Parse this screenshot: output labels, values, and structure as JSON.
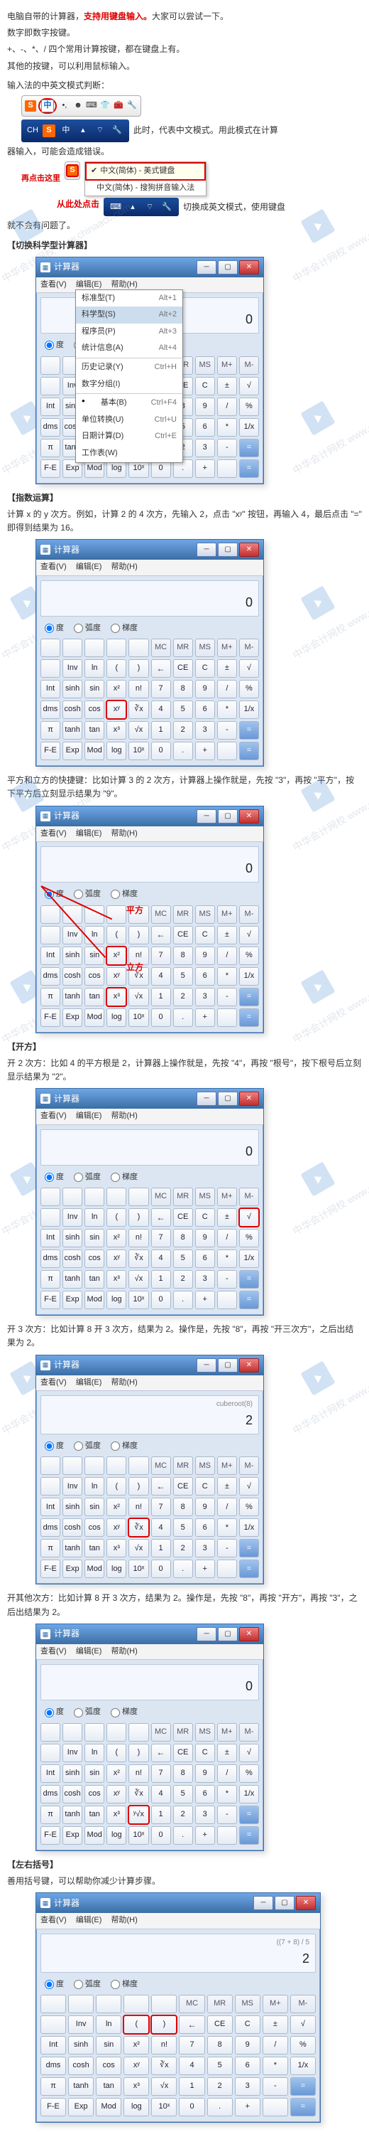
{
  "wm_text": "中华会计网校 www.chinaacc.com",
  "intro": {
    "line1a": "电脑自带的计算器，",
    "line1b": "支持用键盘输入。",
    "line1c": "大家可以尝试一下。",
    "line2": "数字即数字按键。",
    "line3": "+、-、*、/ 四个常用计算按键，都在键盘上有。",
    "line4": "其他的按键，可以利用鼠标输入。",
    "ime_intro": "输入法的中英文模式判断："
  },
  "ime": {
    "cn_char": "中",
    "ch_label": "CH",
    "txt_after_bar": "此时，代表中文模式。用此模式在计算",
    "txt_after_bar2": "器输入，可能会造成错误。",
    "click_here": "再点击这里",
    "menu_opt1": "中文(简体) - 美式键盘",
    "menu_opt2": "中文(简体) - 搜狗拼音输入法",
    "from_here": "从此处点击",
    "switch_en": "切换成英文模式，使用键盘",
    "no_problem": "就不会有问题了。"
  },
  "calc_title": "计算器",
  "menus": {
    "view": "查看(V)",
    "edit": "编辑(E)",
    "help": "帮助(H)"
  },
  "angle_modes": {
    "deg": "度",
    "rad": "弧度",
    "grad": "梯度"
  },
  "mem_row": [
    "MC",
    "MR",
    "MS",
    "M+",
    "M-"
  ],
  "sci_cols_left": [
    [
      "",
      "Inv",
      "ln",
      "(",
      ")"
    ],
    [
      "Int",
      "sinh",
      "sin",
      "x²",
      "n!"
    ],
    [
      "dms",
      "cosh",
      "cos",
      "xʸ",
      "∛x"
    ],
    [
      "π",
      "tanh",
      "tan",
      "x³",
      "√x"
    ],
    [
      "F-E",
      "Exp",
      "Mod",
      "log",
      "10ˣ"
    ]
  ],
  "num_cols_right": [
    [
      "←",
      "CE",
      "C",
      "±",
      "√"
    ],
    [
      "7",
      "8",
      "9",
      "/",
      "%"
    ],
    [
      "4",
      "5",
      "6",
      "*",
      "1/x"
    ],
    [
      "1",
      "2",
      "3",
      "-",
      "="
    ],
    [
      "0",
      ".",
      "+",
      "",
      "="
    ]
  ],
  "drop_menu": [
    {
      "l": "标准型(T)",
      "s": "Alt+1"
    },
    {
      "l": "科学型(S)",
      "s": "Alt+2",
      "sel": true
    },
    {
      "l": "程序员(P)",
      "s": "Alt+3"
    },
    {
      "l": "统计信息(A)",
      "s": "Alt+4"
    },
    {
      "sep": true
    },
    {
      "l": "历史记录(Y)",
      "s": "Ctrl+H"
    },
    {
      "l": "数字分组(I)",
      "s": ""
    },
    {
      "sep": true
    },
    {
      "l": "基本(B)",
      "s": "Ctrl+F4",
      "bullet": true
    },
    {
      "l": "单位转换(U)",
      "s": "Ctrl+U"
    },
    {
      "l": "日期计算(D)",
      "s": "Ctrl+E"
    },
    {
      "l": "工作表(W)",
      "s": ""
    }
  ],
  "sec1": {
    "title": "【切换科学型计算器】",
    "display": "0"
  },
  "sec2": {
    "title": "【指数运算】",
    "desc": "计算 x 的 y 次方。例如，计算 2 的 4 次方，先输入 2，点击 \"xʸ\" 按钮，再输入 4，最后点击 \"=\" 即得到结果为 16。",
    "display": "0",
    "sq_cube_desc": "平方和立方的快捷键：比如计算 3 的 2 次方，计算器上操作就是，先按 \"3\"，再按 \"平方\"，按下平方后立刻显示结果为 \"9\"。",
    "label_sq": "平方",
    "label_cube": "立方"
  },
  "sec3": {
    "title": "【开方】",
    "desc": "开 2 次方：比如 4 的平方根是 2，计算器上操作就是，先按 \"4\"，再按 \"根号\"，按下根号后立刻显示结果为 \"2\"。",
    "display": "0",
    "cube_desc": "开 3 次方：比如计算 8 开 3 次方，结果为 2。操作是，先按 \"8\"，再按 \"开三次方\"，之后出结果为 2。",
    "cube_hist": "cuberoot(8)",
    "cube_display": "2",
    "nth_desc": "开其他次方：比如计算 8 开 3 次方，结果为 2。操作是，先按 \"8\"，再按 \"开方\"，再按 \"3\"，之后出结果为 2。",
    "nth_display": "0"
  },
  "sec4": {
    "title": "【左右括号】",
    "desc": "善用括号键，可以帮助你减少计算步骤。",
    "hist": "((7 + 8) / 5",
    "display": "2"
  },
  "nthroot_label": "ʸ√x"
}
